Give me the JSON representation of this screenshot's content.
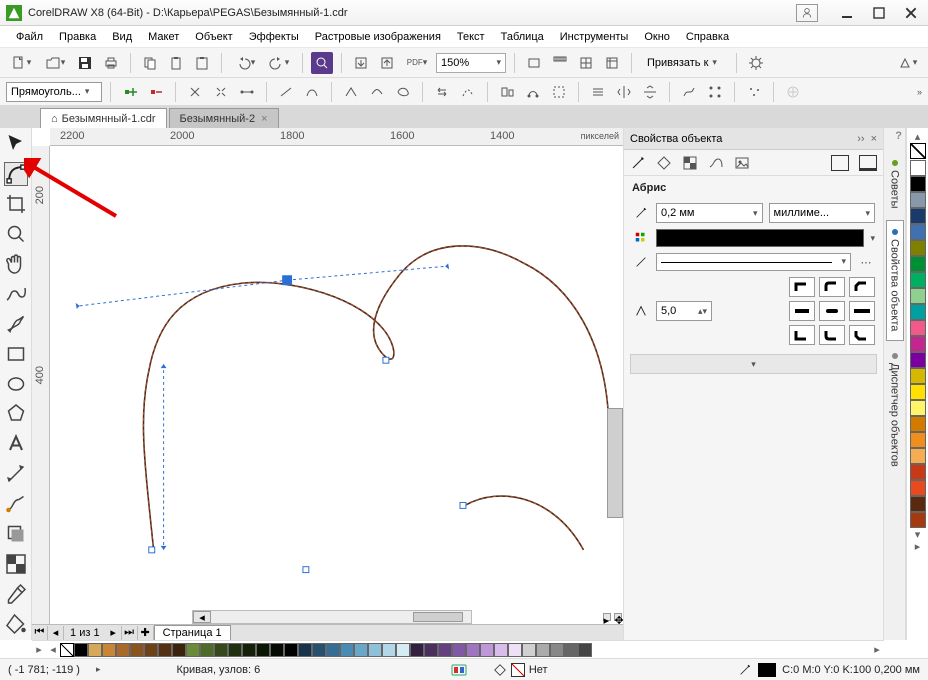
{
  "title": "CorelDRAW X8 (64-Bit) - D:\\Карьера\\PEGAS\\Безымянный-1.cdr",
  "menu": [
    "Файл",
    "Правка",
    "Вид",
    "Макет",
    "Объект",
    "Эффекты",
    "Растровые изображения",
    "Текст",
    "Таблица",
    "Инструменты",
    "Окно",
    "Справка"
  ],
  "toolbar": {
    "zoom": "150%",
    "snap": "Привязать к"
  },
  "propbar": {
    "shape_mode": "Прямоуголь..."
  },
  "tabs": [
    {
      "label": "Безымянный-1.cdr",
      "active": true,
      "home": true
    },
    {
      "label": "Безымянный-2",
      "active": false,
      "home": false
    }
  ],
  "ruler": {
    "unit": "пикселей",
    "hticks": [
      "2200",
      "2000",
      "1800",
      "1600",
      "1400"
    ],
    "vticks": [
      "200",
      "400"
    ]
  },
  "page_nav": {
    "current": "1",
    "sep": "из",
    "total": "1",
    "page_label": "Страница 1"
  },
  "panel": {
    "title": "Свойства объекта",
    "section": "Абрис",
    "width_value": "0,2 мм",
    "unit_label": "миллиме...",
    "miter_value": "5,0"
  },
  "docker": {
    "tab1": "Советы",
    "tab2": "Свойства объекта",
    "tab3": "Диспетчер объектов"
  },
  "status": {
    "coords": "( -1 781; -119 )",
    "info": "Кривая, узлов: 6",
    "fill": "Нет",
    "outline": "C:0 M:0 Y:0 K:100 0,200 мм"
  },
  "palette_colors": [
    "#ffffff",
    "#000000",
    "#1a2a4a",
    "#223a6a",
    "#2b4f8f",
    "#3465b0",
    "#80a5d8",
    "#c7c073",
    "#8c6f20",
    "#6c5115",
    "#4e3a0f",
    "#a35a1f",
    "#c98536",
    "#96551e",
    "#dd7f19",
    "#f29a3a",
    "#e2e2e2",
    "#bdbdbd",
    "#8f8f8f"
  ],
  "vpalette_colors": [
    "#ffffff",
    "#000000",
    "#8899aa",
    "#1a3a6a",
    "#4070b0",
    "#7f7f00",
    "#009033",
    "#00b060",
    "#8fd08f",
    "#00a0a0",
    "#f05a8a",
    "#c3278f",
    "#7a00a0",
    "#d6b800",
    "#ffe000",
    "#fff46a",
    "#d37a00",
    "#ef8d1e",
    "#f4ad55",
    "#c83a15",
    "#e84a20",
    "#5a2a10",
    "#a33a10"
  ]
}
